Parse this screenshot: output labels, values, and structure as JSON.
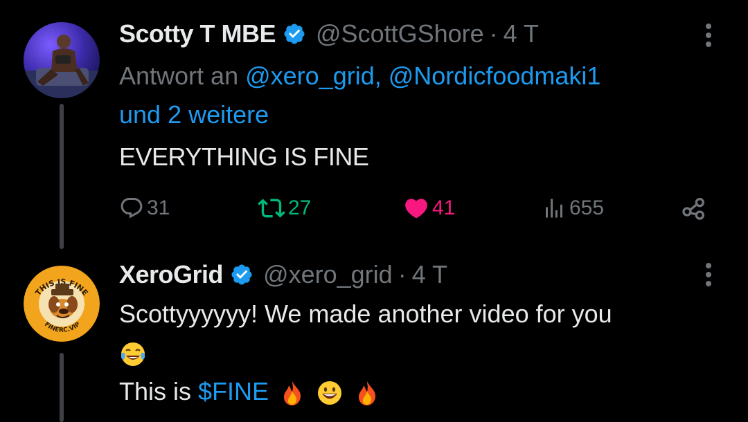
{
  "tweets": [
    {
      "name": "Scotty T MBE",
      "handle": "@ScottGShore",
      "separator": "·",
      "time": "4 T",
      "reply_prefix": "Antwort an",
      "reply_mentions": "@xero_grid, @Nordicfoodmaki1",
      "reply_suffix": "und 2 weitere",
      "text": "EVERYTHING IS FINE",
      "stats": {
        "replies": "31",
        "retweets": "27",
        "likes": "41",
        "views": "655"
      }
    },
    {
      "name": "XeroGrid",
      "handle": "@xero_grid",
      "separator": "·",
      "time": "4 T",
      "text_line1": "Scottyyyyyy! We made another video for you",
      "text_line3_prefix": "This is",
      "cashtag": "$FINE",
      "avatar_ring_text_top": "THIS IS FINE",
      "avatar_ring_text_bottom": "FINERC.VIP"
    }
  ],
  "icons": {
    "verified": "verified-badge-icon",
    "more": "more-options-icon",
    "reply": "reply-icon",
    "retweet": "retweet-icon",
    "like": "heart-icon",
    "views": "views-icon",
    "share": "share-icon"
  },
  "colors": {
    "background": "#000000",
    "text": "#e7e9ea",
    "muted": "#71767b",
    "link": "#1d9bf0",
    "retweet": "#00ba7c",
    "like": "#f91880",
    "verified": "#1d9bf0"
  }
}
